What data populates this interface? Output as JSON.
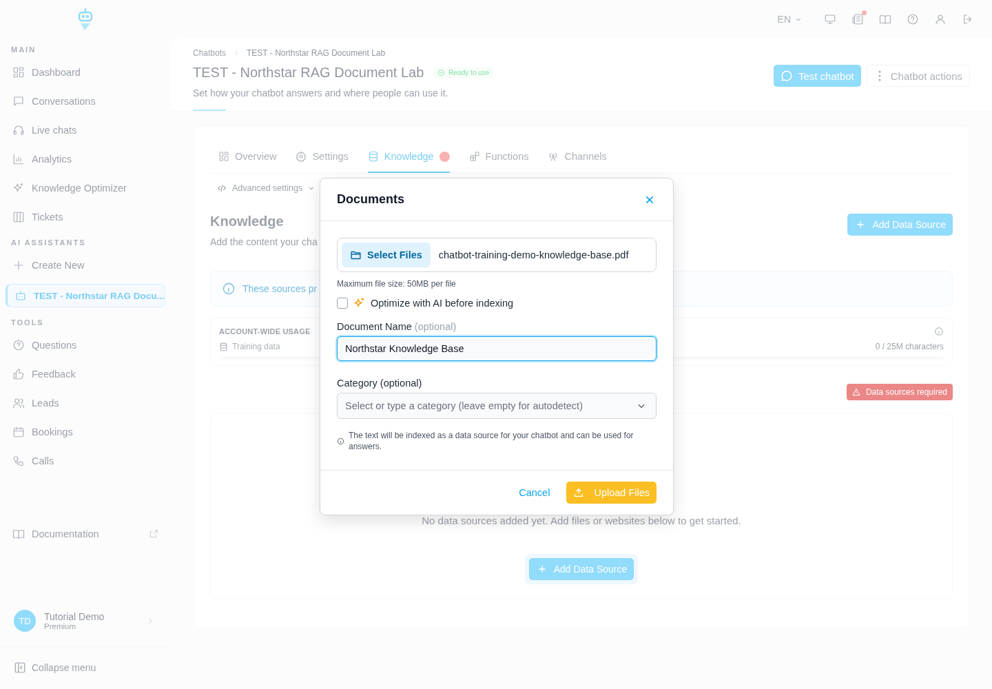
{
  "sidebar": {
    "sections": [
      {
        "title": "MAIN",
        "items": [
          {
            "label": "Dashboard",
            "selected": false
          },
          {
            "label": "Conversations",
            "selected": false
          },
          {
            "label": "Live chats",
            "selected": false
          },
          {
            "label": "Analytics",
            "selected": false
          },
          {
            "label": "Knowledge Optimizer",
            "selected": false
          },
          {
            "label": "Tickets",
            "selected": false
          }
        ]
      },
      {
        "title": "AI ASSISTANTS",
        "items": [
          {
            "label": "Create New",
            "selected": false
          },
          {
            "label": "TEST - Northstar RAG Docu...",
            "selected": true
          }
        ]
      },
      {
        "title": "TOOLS",
        "items": [
          {
            "label": "Questions",
            "selected": false
          },
          {
            "label": "Feedback",
            "selected": false
          },
          {
            "label": "Leads",
            "selected": false
          },
          {
            "label": "Bookings",
            "selected": false
          },
          {
            "label": "Calls",
            "selected": false
          }
        ]
      }
    ],
    "documentation": "Documentation",
    "user": {
      "initials": "TD",
      "name": "Tutorial Demo",
      "plan": "Premium"
    },
    "collapse": "Collapse menu"
  },
  "topbar": {
    "language": "EN",
    "notification": true
  },
  "header": {
    "breadcrumb": [
      "Chatbots",
      "TEST - Northstar RAG Document Lab"
    ],
    "title": "TEST - Northstar RAG Document Lab",
    "status": "Ready to use",
    "subtitle": "Set how your chatbot answers and where people can use it.",
    "buttons": [
      "Test chatbot",
      "Chatbot actions"
    ]
  },
  "tabs": [
    {
      "label": "Overview",
      "selected": false,
      "alert": false
    },
    {
      "label": "Settings",
      "selected": false,
      "alert": false
    },
    {
      "label": "Knowledge",
      "selected": true,
      "alert": true
    },
    {
      "label": "Functions",
      "selected": false,
      "alert": false
    },
    {
      "label": "Channels",
      "selected": false,
      "alert": false
    }
  ],
  "advanced": "Advanced settings",
  "knowledge": {
    "title": "Knowledge",
    "subtitle": "Add the content your cha",
    "add_button": "Add Data Source",
    "info": "These sources pr",
    "usage": {
      "title": "ACCOUNT-WIDE USAGE",
      "label": "Training data",
      "reading": "0 / 25M characters",
      "level": 0
    },
    "warning": "Data sources required",
    "empty": "No data sources added yet. Add files or websites below to get started.",
    "empty_button": "Add Data Source"
  },
  "dialog": {
    "title": "Documents",
    "select_button": "Select Files",
    "file_name": "chatbot-training-demo-knowledge-base.pdf",
    "max_size": "Maximum file size: 50MB per file",
    "optimize": {
      "label": "Optimize with AI before indexing",
      "checked": false
    },
    "name_label": "Document Name",
    "name_hint": "(optional)",
    "name_value": "Northstar Knowledge Base",
    "category_label": "Category (optional)",
    "category_placeholder": "Select or type a category (leave empty for autodetect)",
    "note": "The text will be indexed as a data source for your chatbot and can be used for answers.",
    "buttons": [
      "Cancel",
      "Upload Files"
    ]
  }
}
